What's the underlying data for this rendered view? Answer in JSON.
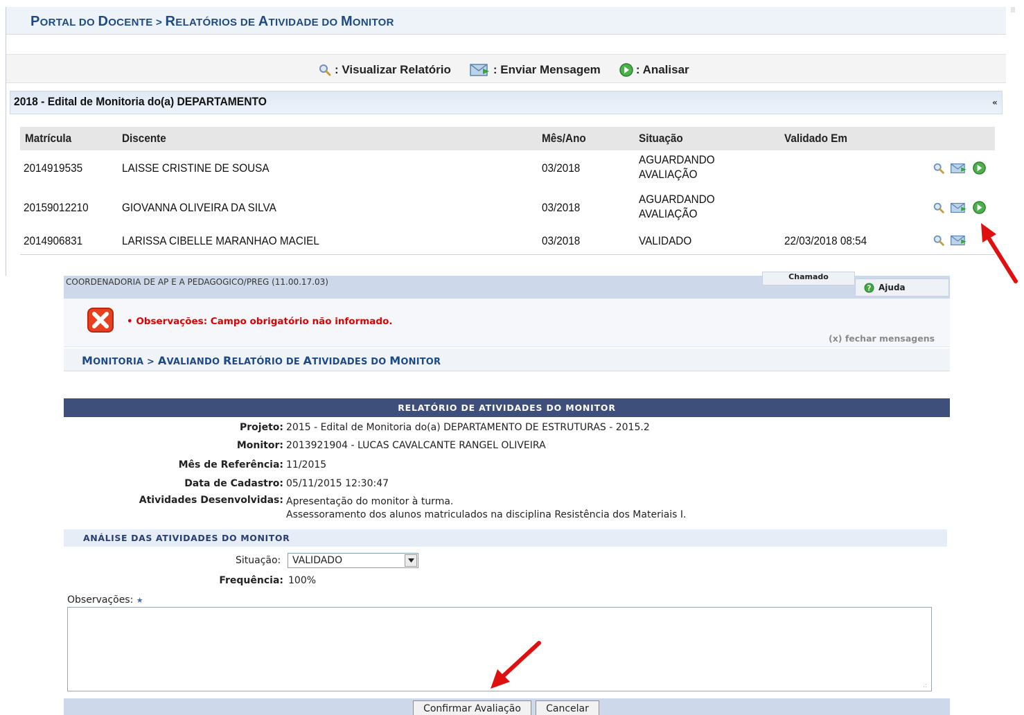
{
  "portal": {
    "title_p": "P",
    "title_1": "ORTAL DO ",
    "title_d": "D",
    "title_2": "OCENTE > ",
    "title_r": "R",
    "title_3": "ELATÓRIOS DE ",
    "title_a": "A",
    "title_4": "TIVIDADE DO ",
    "title_m": "M",
    "title_5": "ONITOR"
  },
  "legend": {
    "visualizar": ": Visualizar Relatório",
    "enviar": ": Enviar Mensagem",
    "analisar": ": Analisar"
  },
  "edital": {
    "title": "2018 - Edital de Monitoria do(a) DEPARTAMENTO",
    "collapse": "«"
  },
  "table": {
    "headers": [
      "Matrícula",
      "Discente",
      "Mês/Ano",
      "Situação",
      "Validado Em"
    ],
    "rows": [
      {
        "matricula": "2014919535",
        "discente": "LAISSE CRISTINE DE SOUSA",
        "mes_ano": "03/2018",
        "situacao_1": "AGUARDANDO",
        "situacao_2": "AVALIAÇÃO",
        "validado": ""
      },
      {
        "matricula": "20159012210",
        "discente": "GIOVANNA OLIVEIRA DA SILVA",
        "mes_ano": "03/2018",
        "situacao_1": "AGUARDANDO",
        "situacao_2": "AVALIAÇÃO",
        "validado": ""
      },
      {
        "matricula": "2014906831",
        "discente": "LARISSA CIBELLE MARANHAO MACIEL",
        "mes_ano": "03/2018",
        "situacao_1": "VALIDADO",
        "situacao_2": "",
        "validado": "22/03/2018 08:54"
      }
    ]
  },
  "header2": {
    "unit": "COORDENADORIA DE AP E A PEDAGOGICO/PREG (11.00.17.03)",
    "chamado": "Chamado",
    "ajuda": "Ajuda"
  },
  "messages": {
    "error": "• Observações: Campo obrigatório não informado.",
    "fechar": "(x) fechar mensagens"
  },
  "monitoria": {
    "t1": "M",
    "t2": "ONITORIA > ",
    "t3": "A",
    "t4": "VALIANDO ",
    "t5": "R",
    "t6": "ELATÓRIO DE ",
    "t7": "A",
    "t8": "TIVIDADES DO ",
    "t9": "M",
    "t10": "ONITOR"
  },
  "relatorio": {
    "header": "RELATÓRIO DE ATIVIDADES DO MONITOR",
    "projeto_label": "Projeto:",
    "projeto": "2015 - Edital de Monitoria do(a) DEPARTAMENTO DE ESTRUTURAS - 2015.2",
    "monitor_label": "Monitor:",
    "monitor": "2013921904 - LUCAS CAVALCANTE RANGEL OLIVEIRA",
    "mes_label": "Mês de Referência:",
    "mes": "11/2015",
    "data_label": "Data de Cadastro:",
    "data": "05/11/2015 12:30:47",
    "atividades_label": "Atividades Desenvolvidas:",
    "atividades_1": "Apresentação do monitor à turma.",
    "atividades_2": "Assessoramento dos alunos matriculados na disciplina Resistência dos Materiais I."
  },
  "analise": {
    "title": "ANÁLISE DAS ATIVIDADES DO MONITOR",
    "situacao_label": "Situação:",
    "situacao_value": "VALIDADO",
    "frequencia_label": "Frequência:",
    "frequencia": "100%",
    "observacoes_label": "Observações:",
    "observacoes_required": "★",
    "observacoes_value": ""
  },
  "buttons": {
    "confirmar": "Confirmar Avaliação",
    "cancelar": "Cancelar"
  },
  "colors": {
    "title_blue": "#1d4a86",
    "error_red": "#e00000",
    "header_navy": "#3e4f7c",
    "annotation_arrow": "#e01010"
  }
}
